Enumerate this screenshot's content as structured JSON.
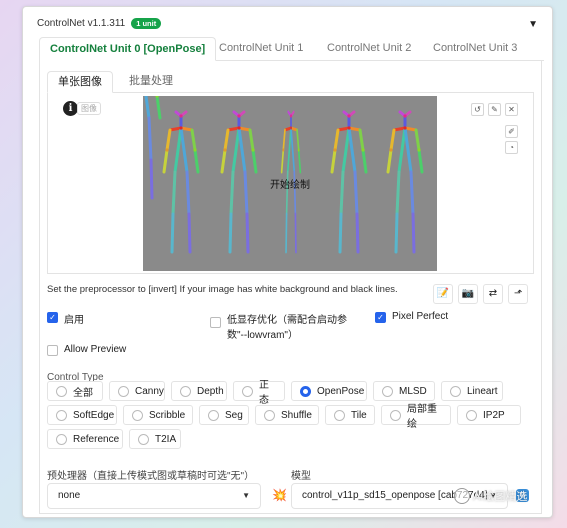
{
  "header": {
    "title": "ControlNet v1.1.311",
    "badge": "1 unit"
  },
  "tabs": [
    {
      "label": "ControlNet Unit 0 [OpenPose]",
      "active": true
    },
    {
      "label": "ControlNet Unit 1"
    },
    {
      "label": "ControlNet Unit 2"
    },
    {
      "label": "ControlNet Unit 3"
    }
  ],
  "subtabs": [
    {
      "label": "单张图像",
      "active": true
    },
    {
      "label": "批量处理"
    }
  ],
  "image": {
    "tag": "图像",
    "canvas_text": "开始绘制"
  },
  "hint": "Set the preprocessor to [invert] If your image has white background and black lines.",
  "checkboxes": {
    "enable": {
      "label": "启用",
      "checked": true
    },
    "lowvram": {
      "label": "低显存优化（需配合启动参数\"--lowvram\"）",
      "checked": false
    },
    "pixel_perfect": {
      "label": "Pixel Perfect",
      "checked": true
    },
    "allow_preview": {
      "label": "Allow Preview",
      "checked": false
    }
  },
  "control_type": {
    "label": "Control Type",
    "selected": "OpenPose",
    "options": [
      "全部",
      "Canny",
      "Depth",
      "正态",
      "OpenPose",
      "MLSD",
      "Lineart",
      "SoftEdge",
      "Scribble",
      "Seg",
      "Shuffle",
      "Tile",
      "局部重绘",
      "IP2P",
      "Reference",
      "T2IA"
    ]
  },
  "preprocessor": {
    "label": "预处理器（直接上传模式图或草稿时可选\"无\"）",
    "value": "none"
  },
  "model": {
    "label": "模型",
    "value": "control_v11p_sd15_openpose [cab727d4]"
  },
  "watermark": "AI绘图精选",
  "colors": {
    "accent": "#15803d",
    "checkbox": "#2563eb",
    "canvas": "#8a8a8a"
  }
}
